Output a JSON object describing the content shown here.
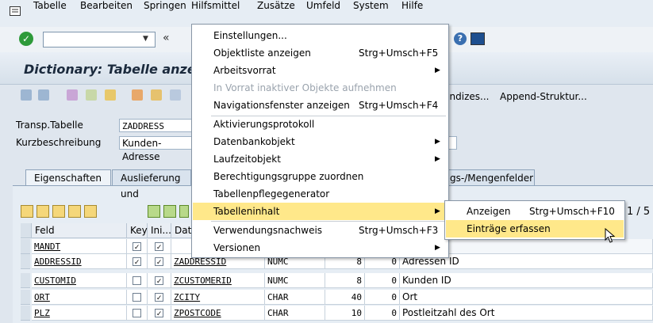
{
  "menubar": [
    "Tabelle",
    "Bearbeiten",
    "Springen",
    "Hilfsmittel",
    "Zusätze",
    "Umfeld",
    "System",
    "Hilfe"
  ],
  "toolbar": {
    "nav": "«"
  },
  "title": "Dictionary: Tabelle anzei",
  "apptoolbar": {
    "indizes": "Indizes...",
    "append": "Append-Struktur..."
  },
  "header": {
    "transp_label": "Transp.Tabelle",
    "transp_value": "ZADDRESS",
    "kurz_label": "Kurzbeschreibung",
    "kurz_value": "Kunden-Adresse"
  },
  "tabs": [
    "Eigenschaften",
    "Auslieferung und",
    "gs-/Mengenfelder"
  ],
  "table": {
    "page": "1 / 5",
    "headers": {
      "feld": "Feld",
      "key": "Key",
      "ini": "Ini...",
      "dat": "Dat"
    },
    "rows": [
      {
        "feld": "MANDT",
        "key": true,
        "ini": true,
        "dat": "",
        "typ": "",
        "len": "",
        "dec": "",
        "desc": ""
      },
      {
        "feld": "ADDRESSID",
        "key": true,
        "ini": true,
        "dat": "ZADDRESSID",
        "typ": "NUMC",
        "len": "8",
        "dec": "0",
        "desc": "Adressen ID"
      },
      {
        "feld": "CUSTOMID",
        "key": false,
        "ini": true,
        "dat": "ZCUSTOMERID",
        "typ": "NUMC",
        "len": "8",
        "dec": "0",
        "desc": "Kunden ID"
      },
      {
        "feld": "ORT",
        "key": false,
        "ini": true,
        "dat": "ZCITY",
        "typ": "CHAR",
        "len": "40",
        "dec": "0",
        "desc": "Ort"
      },
      {
        "feld": "PLZ",
        "key": false,
        "ini": true,
        "dat": "ZPOSTCODE",
        "typ": "CHAR",
        "len": "10",
        "dec": "0",
        "desc": "Postleitzahl des Ort"
      }
    ]
  },
  "hilfsmittel_menu": [
    {
      "label": "Einstellungen...",
      "shortcut": "",
      "submenu": false,
      "disabled": false
    },
    {
      "label": "Objektliste anzeigen",
      "shortcut": "Strg+Umsch+F5",
      "submenu": false,
      "disabled": false
    },
    {
      "label": "Arbeitsvorrat",
      "shortcut": "",
      "submenu": true,
      "disabled": false
    },
    {
      "label": "In Vorrat inaktiver Objekte aufnehmen",
      "shortcut": "",
      "submenu": false,
      "disabled": true
    },
    {
      "label": "Navigationsfenster anzeigen",
      "shortcut": "Strg+Umsch+F4",
      "submenu": false,
      "disabled": false
    },
    {
      "label": "Aktivierungsprotokoll",
      "shortcut": "",
      "submenu": false,
      "disabled": false
    },
    {
      "label": "Datenbankobjekt",
      "shortcut": "",
      "submenu": true,
      "disabled": false
    },
    {
      "label": "Laufzeitobjekt",
      "shortcut": "",
      "submenu": true,
      "disabled": false
    },
    {
      "label": "Berechtigungsgruppe zuordnen",
      "shortcut": "",
      "submenu": false,
      "disabled": false
    },
    {
      "label": "Tabellenpflegegenerator",
      "shortcut": "",
      "submenu": false,
      "disabled": false
    },
    {
      "label": "Tabelleninhalt",
      "shortcut": "",
      "submenu": true,
      "disabled": false
    },
    {
      "label": "Verwendungsnachweis",
      "shortcut": "Strg+Umsch+F3",
      "submenu": false,
      "disabled": false
    },
    {
      "label": "Versionen",
      "shortcut": "",
      "submenu": true,
      "disabled": false
    }
  ],
  "submenu": [
    {
      "label": "Anzeigen",
      "shortcut": "Strg+Umsch+F10"
    },
    {
      "label": "Einträge erfassen",
      "shortcut": ""
    }
  ],
  "colors": {
    "highlight": "#ffe88a",
    "title": "#1b2a3d"
  }
}
